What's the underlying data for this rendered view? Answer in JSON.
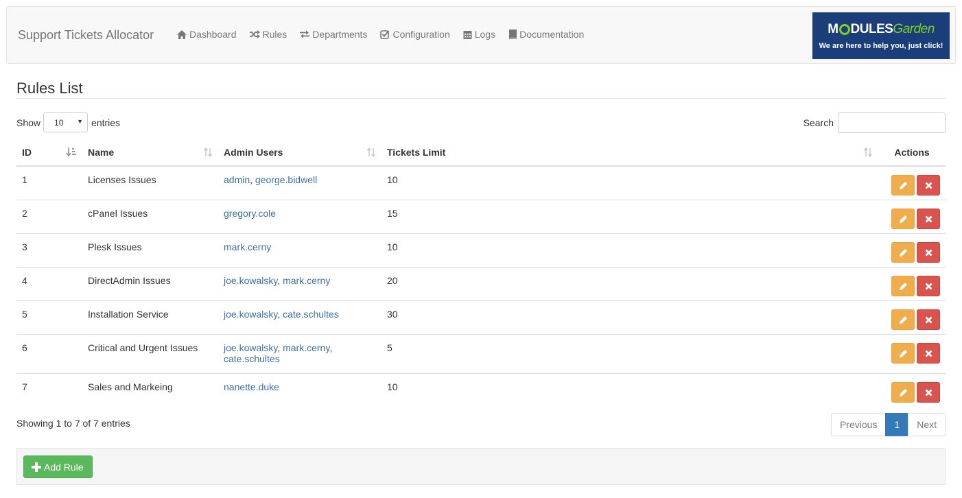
{
  "app": {
    "brand": "Support Tickets Allocator"
  },
  "nav": {
    "items": [
      {
        "label": "Dashboard",
        "icon": "home-icon"
      },
      {
        "label": "Rules",
        "icon": "shuffle-icon"
      },
      {
        "label": "Departments",
        "icon": "exchange-icon"
      },
      {
        "label": "Configuration",
        "icon": "check-square-icon"
      },
      {
        "label": "Logs",
        "icon": "calendar-icon"
      },
      {
        "label": "Documentation",
        "icon": "book-icon"
      }
    ]
  },
  "logo": {
    "brand_part1": "M",
    "brand_part2": "DULES",
    "brand_part3": "Garden",
    "tagline": "We are here to help you, just click!"
  },
  "page": {
    "title": "Rules List"
  },
  "controls": {
    "show_label": "Show",
    "entries_label": "entries",
    "page_length": "10",
    "search_label": "Search",
    "search_value": ""
  },
  "table": {
    "headers": {
      "id": "ID",
      "name": "Name",
      "admins": "Admin Users",
      "limit": "Tickets Limit",
      "actions": "Actions"
    },
    "rows": [
      {
        "id": "1",
        "name": "Licenses Issues",
        "admins": [
          "admin",
          "george.bidwell"
        ],
        "limit": "10"
      },
      {
        "id": "2",
        "name": "cPanel Issues",
        "admins": [
          "gregory.cole"
        ],
        "limit": "15"
      },
      {
        "id": "3",
        "name": "Plesk Issues",
        "admins": [
          "mark.cerny"
        ],
        "limit": "10"
      },
      {
        "id": "4",
        "name": "DirectAdmin Issues",
        "admins": [
          "joe.kowalsky",
          "mark.cerny"
        ],
        "limit": "20"
      },
      {
        "id": "5",
        "name": "Installation Service",
        "admins": [
          "joe.kowalsky",
          "cate.schultes"
        ],
        "limit": "30"
      },
      {
        "id": "6",
        "name": "Critical and Urgent Issues",
        "admins": [
          "joe.kowalsky",
          "mark.cerny",
          "cate.schultes"
        ],
        "limit": "5"
      },
      {
        "id": "7",
        "name": "Sales and Markeing",
        "admins": [
          "nanette.duke"
        ],
        "limit": "10"
      }
    ]
  },
  "pagination": {
    "info": "Showing 1 to 7 of 7 entries",
    "previous": "Previous",
    "current": "1",
    "next": "Next"
  },
  "footer": {
    "add_label": "Add Rule"
  },
  "colors": {
    "link": "#3c6fa7",
    "edit": "#f0ad4e",
    "delete": "#d9534f",
    "add": "#5cb85c",
    "page_active": "#337ab7",
    "logo_bg": "#1b3e7b",
    "logo_green": "#7ed321"
  }
}
